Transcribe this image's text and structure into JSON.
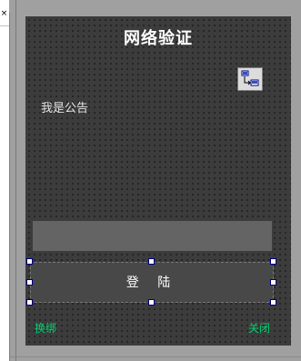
{
  "toolbox": {
    "close_glyph": "×"
  },
  "form": {
    "title": "网络验证",
    "notice": "我是公告",
    "login_button": "登 陆",
    "unbind_link": "换绑",
    "close_link": "关闭"
  },
  "colors": {
    "form_bg": "#3c3c3c",
    "input_bg": "#646464",
    "button_bg": "#484848",
    "link": "#00d070",
    "handle_border": "#000080"
  }
}
